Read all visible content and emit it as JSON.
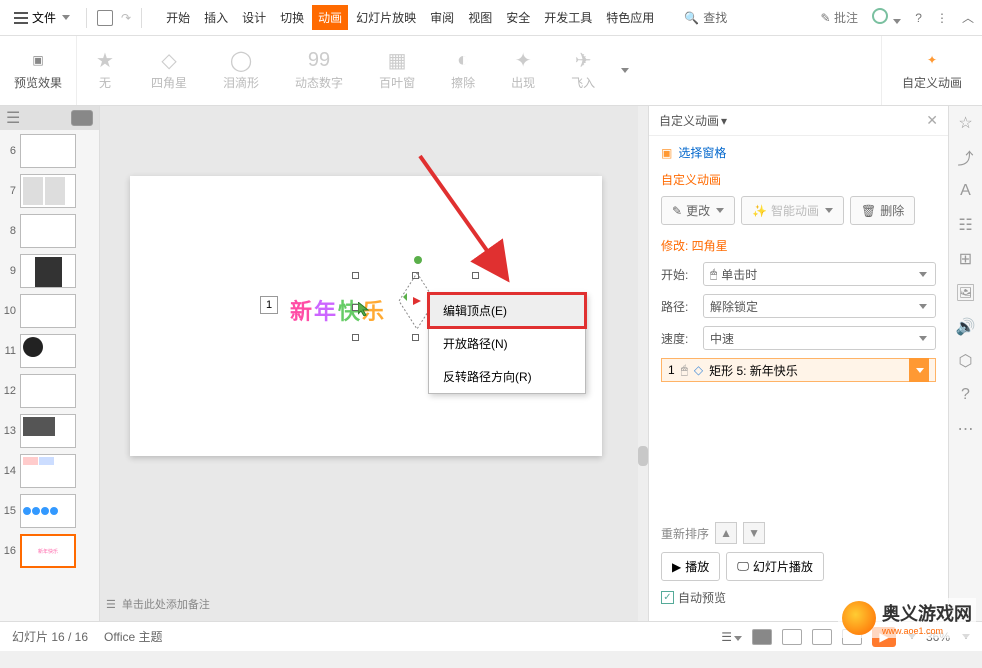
{
  "menubar": {
    "file_label": "文件",
    "tabs": [
      "开始",
      "插入",
      "设计",
      "切换",
      "动画",
      "幻灯片放映",
      "审阅",
      "视图",
      "安全",
      "开发工具",
      "特色应用"
    ],
    "active_tab": "动画",
    "search_label": "查找",
    "annotate_label": "批注"
  },
  "ribbon": {
    "preview_label": "预览效果",
    "effects": [
      "无",
      "四角星",
      "泪滴形",
      "动态数字",
      "百叶窗",
      "擦除",
      "出现",
      "飞入"
    ],
    "custom_anim_label": "自定义动画"
  },
  "thumbs": {
    "items": [
      {
        "num": "6"
      },
      {
        "num": "7"
      },
      {
        "num": "8"
      },
      {
        "num": "9"
      },
      {
        "num": "10"
      },
      {
        "num": "11"
      },
      {
        "num": "12"
      },
      {
        "num": "13"
      },
      {
        "num": "14"
      },
      {
        "num": "15"
      },
      {
        "num": "16"
      }
    ],
    "selected": "16"
  },
  "canvas": {
    "text_chars": [
      "新",
      "年",
      "快",
      "乐"
    ],
    "seq_num": "1",
    "context_menu": {
      "edit_points": "编辑顶点(E)",
      "open_path": "开放路径(N)",
      "reverse_path": "反转路径方向(R)"
    },
    "notes_placeholder": "单击此处添加备注"
  },
  "panel": {
    "title": "自定义动画",
    "select_pane": "选择窗格",
    "section_custom": "自定义动画",
    "btn_change": "更改",
    "btn_smart": "智能动画",
    "btn_delete": "删除",
    "modify_title": "修改: 四角星",
    "start_label": "开始:",
    "start_value": "单击时",
    "path_label": "路径:",
    "path_value": "解除锁定",
    "speed_label": "速度:",
    "speed_value": "中速",
    "anim_item_num": "1",
    "anim_item_label": "矩形 5: 新年快乐",
    "reorder_label": "重新排序",
    "btn_play": "播放",
    "btn_slideshow": "幻灯片播放",
    "auto_preview": "自动预览"
  },
  "statusbar": {
    "slide_info": "幻灯片 16 / 16",
    "theme": "Office 主题",
    "zoom": "36%"
  },
  "watermark": {
    "name": "奥义游戏网",
    "url": "www.aoe1.com"
  }
}
